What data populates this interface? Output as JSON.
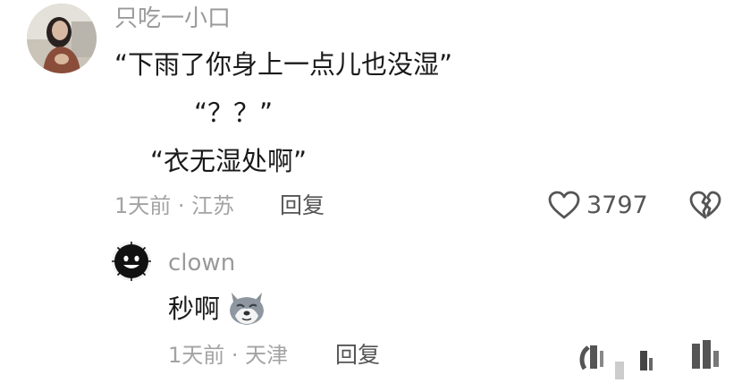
{
  "comment": {
    "username": "只吃一小口",
    "lines": [
      "“下雨了你身上一点儿也没湿”",
      "“？？”",
      "“衣无湿处啊”"
    ],
    "meta": "1天前 · 江苏",
    "reply_label": "回复",
    "like_count": "3797"
  },
  "reply": {
    "username": "clown",
    "text": "秒啊",
    "meta": "1天前 · 天津",
    "reply_label": "回复"
  },
  "icons": {
    "heart": "heart-icon",
    "dislike": "broken-heart-icon",
    "emoji": "wolf-emoji-icon"
  }
}
